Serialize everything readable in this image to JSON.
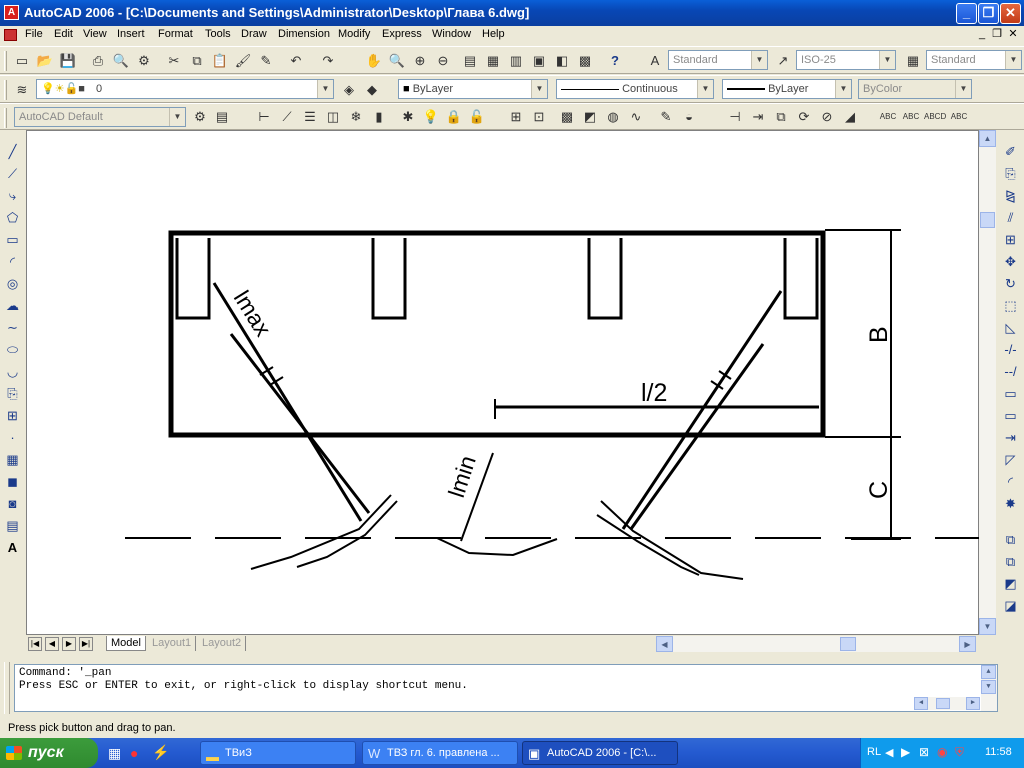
{
  "title_bar": {
    "app_icon_letter": "A",
    "title": "AutoCAD 2006 - [C:\\Documents and Settings\\Administrator\\Desktop\\Глава 6.dwg]"
  },
  "menu": [
    "File",
    "Edit",
    "View",
    "Insert",
    "Format",
    "Tools",
    "Draw",
    "Dimension",
    "Modify",
    "Express",
    "Window",
    "Help"
  ],
  "toolbar": {
    "text_style": "Standard",
    "dim_style": "ISO-25",
    "table_style": "Standard",
    "layer": "0",
    "color": "ByLayer",
    "linetype": "Continuous",
    "lineweight": "ByLayer",
    "plot_style": "ByColor",
    "workspace": "AutoCAD Default"
  },
  "drawing": {
    "label_lmax": "lmax",
    "label_lmin": "lmin",
    "label_half": "l/2",
    "label_b": "B",
    "label_c": "C"
  },
  "tabs": {
    "model": "Model",
    "layout1": "Layout1",
    "layout2": "Layout2"
  },
  "command": {
    "line1": "Command: '_pan",
    "line2": "Press ESC or ENTER to exit, or right-click to display shortcut menu."
  },
  "status": "Press pick button and drag to pan.",
  "taskbar": {
    "start": "пуск",
    "tasks": [
      "ТВиЗ",
      "ТВЗ гл. 6. правлена ...",
      "AutoCAD 2006 - [C:\\..."
    ],
    "lang": "RL",
    "clock": "11:58"
  }
}
